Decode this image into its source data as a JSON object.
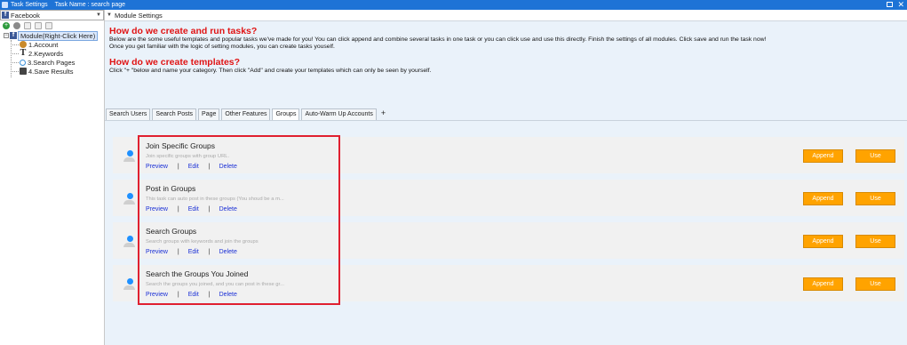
{
  "titlebar": {
    "left_text": "Task Settings",
    "task_name": "Task Name : search page"
  },
  "left_panel": {
    "project_select": "Facebook",
    "tree": {
      "root": "Module(Right-Click Here)",
      "children": [
        "1.Account",
        "2.Keywords",
        "3.Search Pages",
        "4.Save Results"
      ]
    }
  },
  "module_header": "Module Settings",
  "info": {
    "title1": "How do we create and run tasks?",
    "text1a": "Below are the some useful templates and popular tasks we've made for you!  You can click append and combine several tasks in one task or you can click use and use this directly. Finish the settings of all modules. Click save and run the task now!",
    "text1b": "Once you get familiar with the logic of setting modules, you can create tasks youself.",
    "title2": "How do we create templates?",
    "text2": "Click \"+ \"below and name your category. Then click \"Add\" and create your templates which can only be seen by yourself."
  },
  "tabs": [
    "Search Users",
    "Search Posts",
    "Page",
    "Other Features",
    "Groups",
    "Auto-Warm Up  Accounts",
    "+"
  ],
  "active_tab": "Groups",
  "tasks": [
    {
      "title": "Join Specific Groups",
      "desc": "Join specific groups with group URL.",
      "preview": "Preview",
      "edit": "Edit",
      "delete": "Delete",
      "append": "Append",
      "use": "Use"
    },
    {
      "title": "Post in Groups",
      "desc": "This task can auto post in these groups (You shoud be a m...",
      "preview": "Preview",
      "edit": "Edit",
      "delete": "Delete",
      "append": "Append",
      "use": "Use"
    },
    {
      "title": "Search Groups",
      "desc": "Search groups with keywords and join the groups",
      "preview": "Preview",
      "edit": "Edit",
      "delete": "Delete",
      "append": "Append",
      "use": "Use"
    },
    {
      "title": "Search the Groups You Joined",
      "desc": "Search the groups you joined, and you can post in these gr...",
      "preview": "Preview",
      "edit": "Edit",
      "delete": "Delete",
      "append": "Append",
      "use": "Use"
    }
  ],
  "link_separator": "|",
  "colors": {
    "titlebar": "#1e73d6",
    "heading_red": "#e01414",
    "button_orange": "#ffa300",
    "link_blue": "#1a2fd6",
    "highlight_red": "#e02030"
  }
}
